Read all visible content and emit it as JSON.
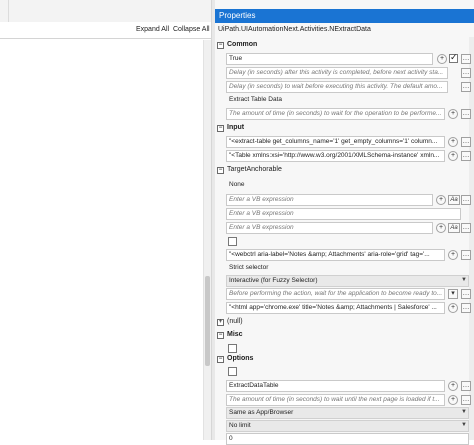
{
  "left": {
    "expand_all": "Expand All",
    "collapse_all": "Collapse All"
  },
  "properties": {
    "title": "Properties",
    "type_name": "UiPath.UIAutomationNext.Activities.NExtractData",
    "common": {
      "label": "Common",
      "continue_on_error": "True",
      "delay_after_ph": "Delay (in seconds) after this activity is completed, before next activity sta...",
      "delay_before_ph": "Delay (in seconds) to wait before executing this activity. The default amo...",
      "display_name": "Extract Table Data",
      "timeout_ph": "The amount of time (in seconds) to wait for the operation to be performe..."
    },
    "input": {
      "label": "Input",
      "extract_metadata": "\"<extract-table get_columns_name='1' get_empty_columns='1' column...",
      "table_data": "\"<Table xmlns:xsi='http://www.w3.org/2001/XMLSchema-instance' xmln..."
    },
    "target_anchorable": {
      "label": "TargetAnchorable",
      "none_text": "None",
      "vb1_ph": "Enter a VB expression",
      "vb2_ph": "Enter a VB expression",
      "vb3_ph": "Enter a VB expression",
      "selector": "\"<webctrl aria-label='Notes &amp; Attachments' aria-role='grid' tag='...",
      "strict_selector": "Strict selector",
      "interactive": "Interactive (for Fuzzy Selector)",
      "wait_ph": "Before performing the action, wait for the application to become ready to...",
      "window_selector": "\"<html app='chrome.exe' title='Notes &amp; Attachments | Salesforce' ..."
    },
    "null_text": "(null)",
    "misc": {
      "label": "Misc"
    },
    "options": {
      "label": "Options",
      "datatable": "ExtractDataTable",
      "next_page_ph": "The amount of time (in seconds) to wait until the next page is loaded if t...",
      "same_as": "Same as App/Browser",
      "no_limit": "No limit",
      "last_val": "0"
    }
  },
  "colors": {
    "header_bg": "#1a74d3",
    "pane_bg": "#f7f7f7"
  }
}
